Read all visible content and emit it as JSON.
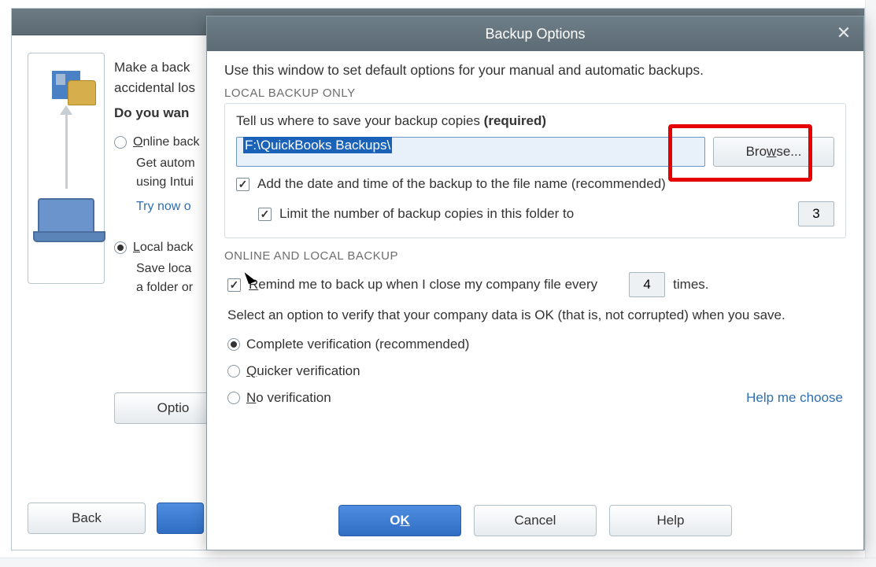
{
  "bg_window": {
    "intro_line1": "Make a back",
    "intro_line2": "accidental los",
    "question": "Do you wan",
    "online_label_pre": "O",
    "online_label_post": "nline back",
    "online_sub_line1": "Get autom",
    "online_sub_line2": "using Intui",
    "try_now": "Try now o",
    "local_label_pre": "L",
    "local_label_post": "ocal back",
    "local_sub_line1": "Save loca",
    "local_sub_line2": "a folder or",
    "options_btn": "Optio",
    "back_btn": "Back"
  },
  "modal": {
    "title": "Backup Options",
    "intro": "Use this window to set default options for your manual and automatic backups.",
    "section_local": "LOCAL BACKUP ONLY",
    "tell_us_pre": "Tell us where to save your backup copies ",
    "tell_us_req": "(required)",
    "path_value": "F:\\QuickBooks Backups\\",
    "browse_pre": "Bro",
    "browse_u": "w",
    "browse_post": "se...",
    "add_date_label": "Add the date and time of the backup to the file name (recommended)",
    "limit_label": "Limit the number of backup copies in this folder to",
    "limit_value": "3",
    "section_online": "ONLINE AND LOCAL BACKUP",
    "remind_pre": "R",
    "remind_post": "emind me to back up when I close my company file every",
    "remind_value": "4",
    "remind_times": "times.",
    "verify_intro": "Select an option to verify that your company data is OK (that is, not corrupted) when you save.",
    "verify_complete": "Complete verification (recommended)",
    "verify_quicker_pre": "Q",
    "verify_quicker_post": "uicker verification",
    "verify_none_pre": "N",
    "verify_none_post": "o verification",
    "help_choose": "Help me choose",
    "ok_pre": "O",
    "ok_u": "K",
    "cancel": "Cancel",
    "help": "Help"
  }
}
